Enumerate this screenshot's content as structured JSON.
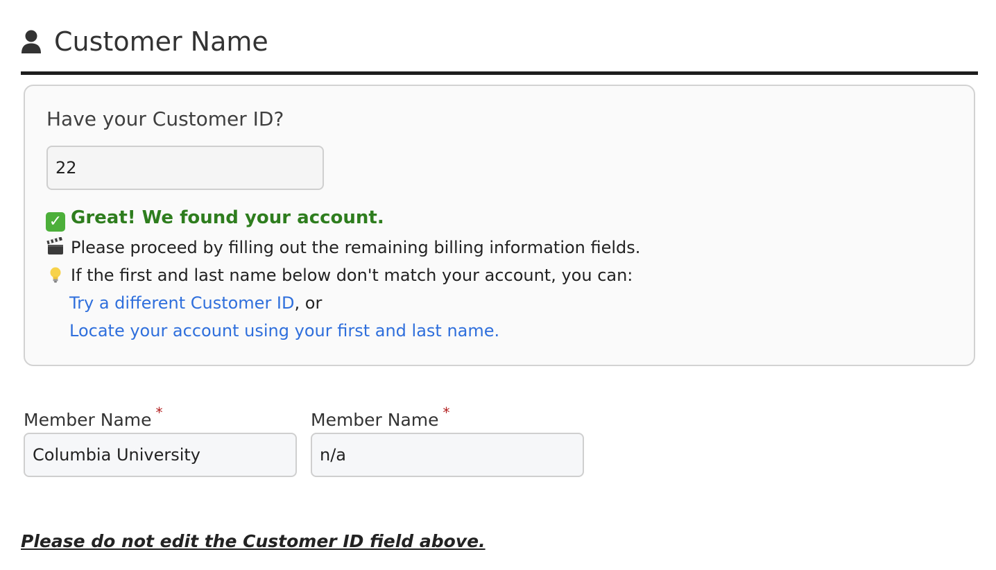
{
  "section": {
    "title": "Customer Name",
    "icon": "user-icon"
  },
  "lookup": {
    "label": "Have your Customer ID?",
    "customer_id_value": "22",
    "success_message": "Great! We found your account.",
    "proceed_message": "Please proceed by filling out the remaining billing information fields.",
    "hint_message": "If the first and last name below don't match your account, you can:",
    "link_try_different": "Try a different Customer ID",
    "link_separator": ", or",
    "link_locate": "Locate your account using your first and last name.",
    "colors": {
      "success": "#2e7d1e",
      "link": "#2f6fdc"
    }
  },
  "fields": {
    "first": {
      "label": "Member Name",
      "required_mark": "*",
      "value": "Columbia University"
    },
    "last": {
      "label": "Member Name",
      "required_mark": "*",
      "value": "n/a"
    }
  },
  "warning": "Please do not edit the Customer ID field above."
}
